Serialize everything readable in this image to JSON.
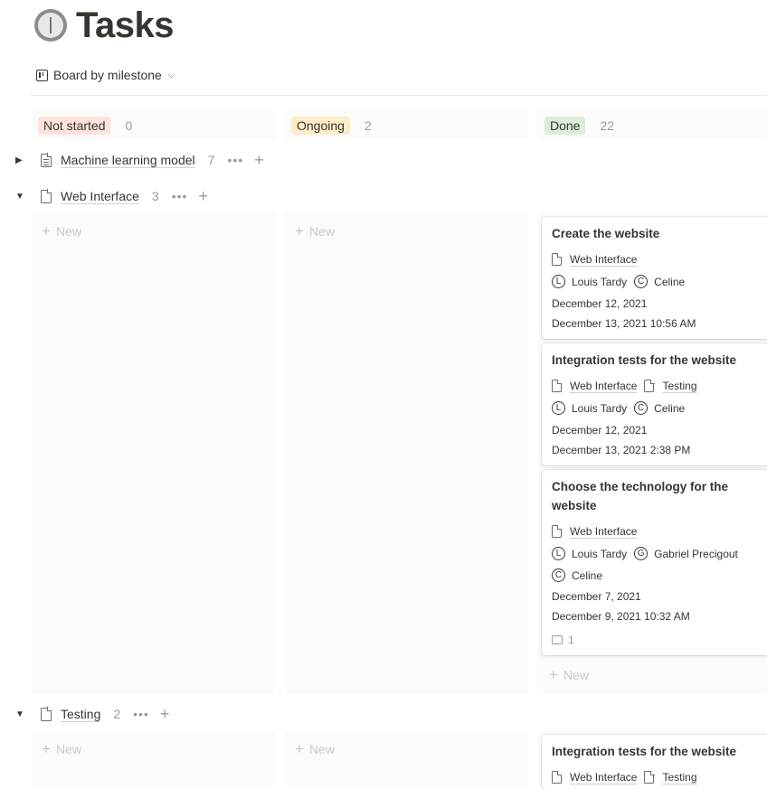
{
  "page": {
    "title": "Tasks",
    "icon": "clock-icon"
  },
  "view": {
    "label": "Board by milestone",
    "icon": "board-icon"
  },
  "columns": [
    {
      "label": "Not started",
      "count": "0",
      "color": "#ffe2dd"
    },
    {
      "label": "Ongoing",
      "count": "2",
      "color": "#fdecc8"
    },
    {
      "label": "Done",
      "count": "22",
      "color": "#dbeddb"
    }
  ],
  "new_label": "New",
  "groups": {
    "machine_learning": {
      "name": "Machine learning model",
      "count": "7",
      "collapsed": true
    },
    "web_interface": {
      "name": "Web Interface",
      "count": "3",
      "collapsed": false
    },
    "testing": {
      "name": "Testing",
      "count": "2",
      "collapsed": false
    }
  },
  "cards": [
    {
      "title": "Create the website",
      "milestones": [
        "Web Interface"
      ],
      "people": [
        {
          "initial": "L",
          "name": "Louis Tardy"
        },
        {
          "initial": "C",
          "name": "Celine"
        }
      ],
      "date": "December 12, 2021",
      "edited": "December 13, 2021 10:56 AM"
    },
    {
      "title": "Integration tests for the website",
      "milestones": [
        "Web Interface",
        "Testing"
      ],
      "people": [
        {
          "initial": "L",
          "name": "Louis Tardy"
        },
        {
          "initial": "C",
          "name": "Celine"
        }
      ],
      "date": "December 12, 2021",
      "edited": "December 13, 2021 2:38 PM"
    },
    {
      "title_line1": "Choose the technology for the",
      "title_line2": "website",
      "milestones": [
        "Web Interface"
      ],
      "people": [
        {
          "initial": "L",
          "name": "Louis Tardy"
        },
        {
          "initial": "G",
          "name": "Gabriel Precigout"
        },
        {
          "initial": "C",
          "name": "Celine"
        }
      ],
      "date": "December 7, 2021",
      "edited": "December 9, 2021 10:32 AM",
      "comments": "1"
    }
  ],
  "testing_card": {
    "title": "Integration tests for the website",
    "milestones": [
      "Web Interface",
      "Testing"
    ]
  }
}
